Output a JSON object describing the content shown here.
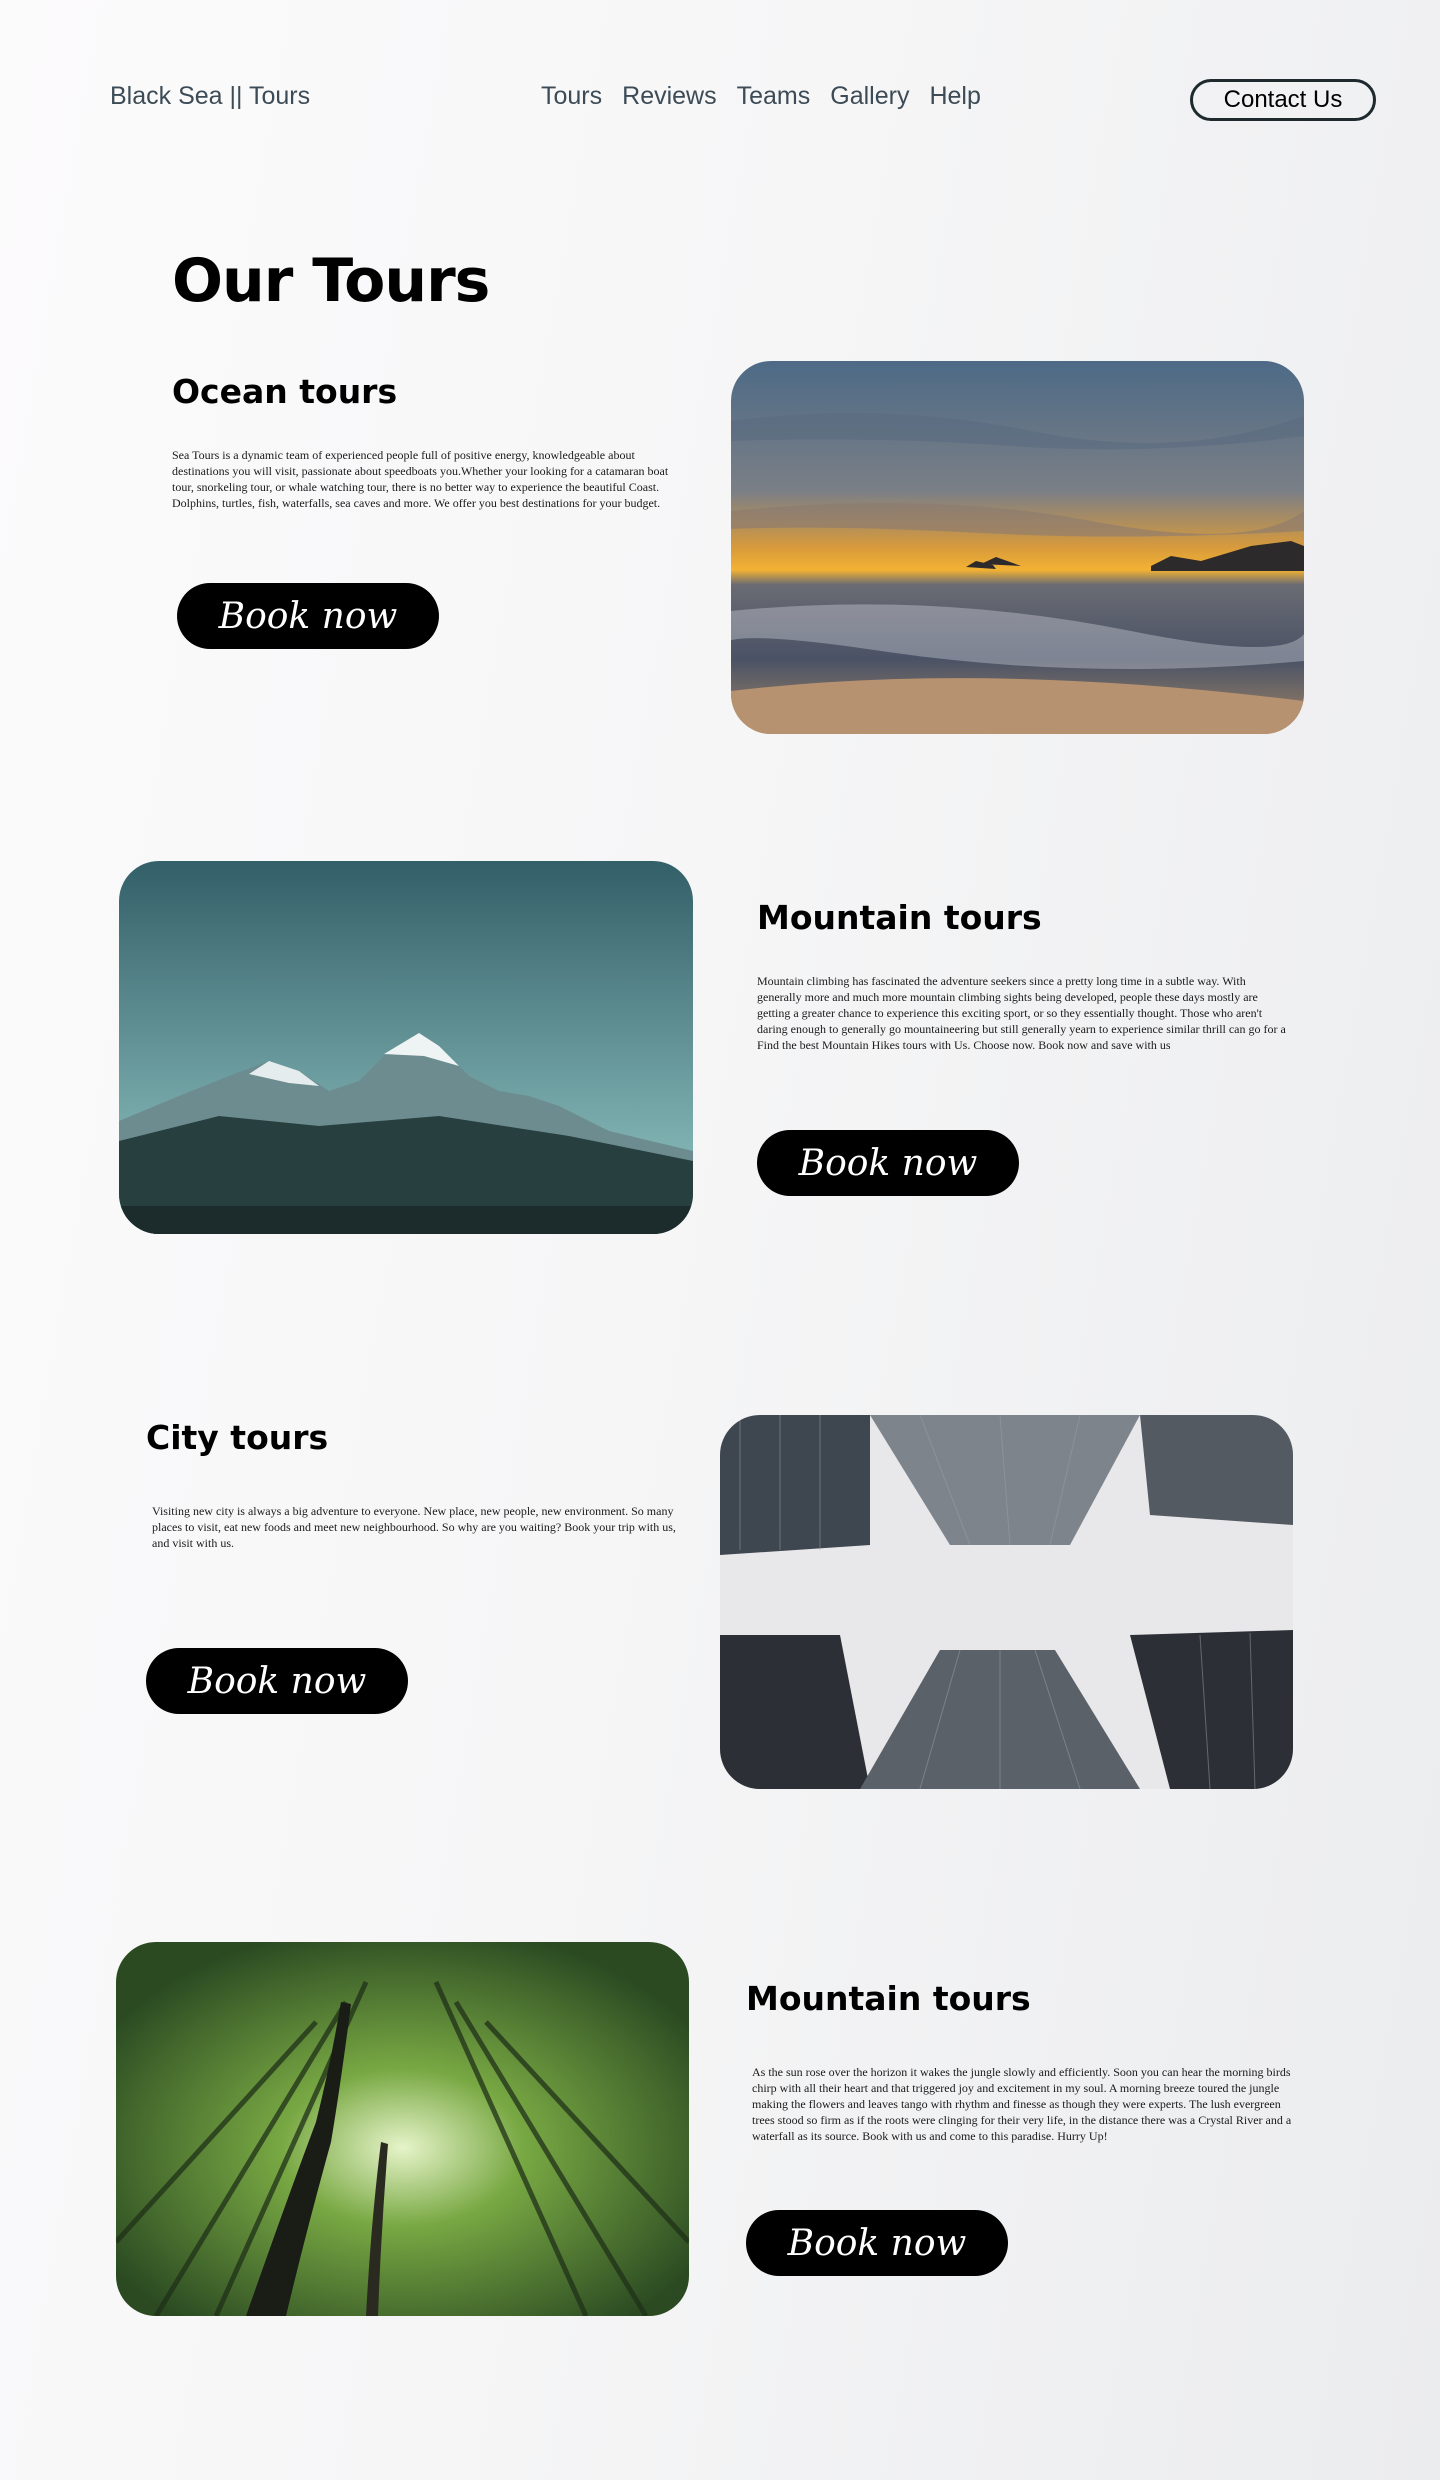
{
  "nav": {
    "brand": "Black Sea || Tours",
    "links": [
      "Tours",
      "Reviews",
      "Teams",
      "Gallery",
      "Help"
    ],
    "contact_label": "Contact Us"
  },
  "page": {
    "title": "Our Tours"
  },
  "tours": [
    {
      "title": "Ocean tours",
      "description": "Sea Tours is a dynamic team of experienced people full of positive energy, knowledgeable about destinations you will visit, passionate about speedboats you.Whether your looking for a catamaran boat tour, snorkeling tour, or whale watching tour, there is no better way to experience the beautiful Coast. Dolphins, turtles, fish, waterfalls, sea caves and more. We offer you best destinations for your budget.",
      "button": "Book now",
      "image": "ocean-sunset-photo"
    },
    {
      "title": "Mountain tours",
      "description": "Mountain climbing has fascinated the adventure seekers since a pretty long time in a subtle way. With generally more and much more mountain climbing sights being developed, people these days mostly are getting a greater chance to experience this exciting sport, or so they essentially thought. Those who aren't daring enough to generally go mountaineering but still generally yearn to experience similar thrill can go for a Find the best Mountain Hikes tours with Us. Choose now. Book now and save with us",
      "button": "Book now",
      "image": "mountain-peaks-photo"
    },
    {
      "title": "City tours",
      "description": "Visiting new city is always a big adventure to everyone. New place, new people, new environment. So many places to visit, eat new foods and meet new neighbourhood. So why are you waiting? Book your trip with us, and visit with us.",
      "button": "Book now",
      "image": "city-skyscrapers-photo"
    },
    {
      "title": "Mountain tours",
      "description": "As the sun rose over the horizon it wakes the jungle slowly and efficiently. Soon you can hear the morning birds chirp with all their heart and that triggered joy and excitement in my soul. A morning breeze toured the jungle making the flowers and leaves tango with rhythm and finesse as though they were experts. The lush evergreen trees stood so firm as if the roots were clinging for their very life, in the distance there was a Crystal River and a waterfall as its source. Book with us and come to this paradise. Hurry Up!",
      "button": "Book now",
      "image": "bamboo-forest-photo"
    }
  ]
}
